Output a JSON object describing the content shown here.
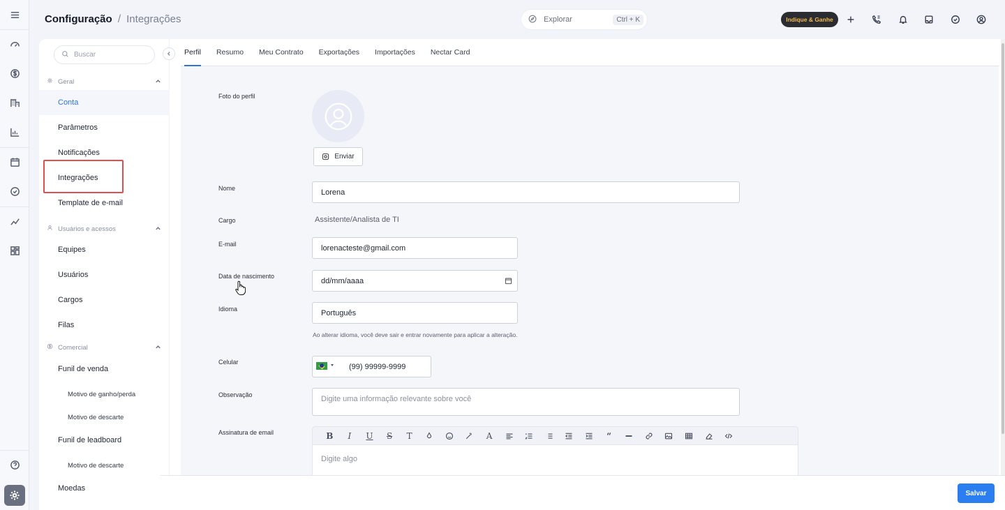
{
  "header": {
    "breadcrumb_root": "Configuração",
    "breadcrumb_sep": "/",
    "breadcrumb_current": "Integrações",
    "explore_label": "Explorar",
    "explore_shortcut": "Ctrl + K",
    "promo_label": "Indique & Ganhe"
  },
  "sidebar": {
    "search_placeholder": "Buscar",
    "groups": {
      "geral": "Geral",
      "usuarios": "Usuários e acessos",
      "comercial": "Comercial"
    },
    "items": {
      "conta": "Conta",
      "parametros": "Parâmetros",
      "notificacoes": "Notificações",
      "integracoes": "Integrações",
      "template": "Template de e-mail",
      "equipes": "Equipes",
      "usuarios": "Usuários",
      "cargos": "Cargos",
      "filas": "Filas",
      "funil_venda": "Funil de venda",
      "motivo_ganho": "Motivo de ganho/perda",
      "motivo_descarte_1": "Motivo de descarte",
      "funil_leadboard": "Funil de leadboard",
      "motivo_descarte_2": "Motivo de descarte",
      "moedas": "Moedas"
    }
  },
  "tabs": [
    "Perfil",
    "Resumo",
    "Meu Contrato",
    "Exportações",
    "Importações",
    "Nectar Card"
  ],
  "form": {
    "foto_label": "Foto do perfil",
    "enviar_label": "Enviar",
    "nome_label": "Nome",
    "nome_value": "Lorena",
    "cargo_label": "Cargo",
    "cargo_value": "Assistente/Analista de TI",
    "email_label": "E-mail",
    "email_value": "lorenacteste@gmail.com",
    "nascimento_label": "Data de nascimento",
    "nascimento_value": "dd/mm/aaaa",
    "idioma_label": "Idioma",
    "idioma_value": "Português",
    "idioma_hint": "Ao alterar idioma, você deve sair e entrar novamente para aplicar a alteração.",
    "celular_label": "Celular",
    "celular_value": "(99) 99999-9999",
    "observacao_label": "Observação",
    "observacao_placeholder": "Digite uma informação relevante sobre você",
    "assinatura_label": "Assinatura de email",
    "assinatura_placeholder": "Digite algo"
  },
  "footer": {
    "save_label": "Salvar"
  },
  "colors": {
    "accent": "#2a7ef0",
    "highlight": "#e04e4e",
    "promo_bg": "#2b2d33",
    "promo_text": "#f4b84a"
  }
}
